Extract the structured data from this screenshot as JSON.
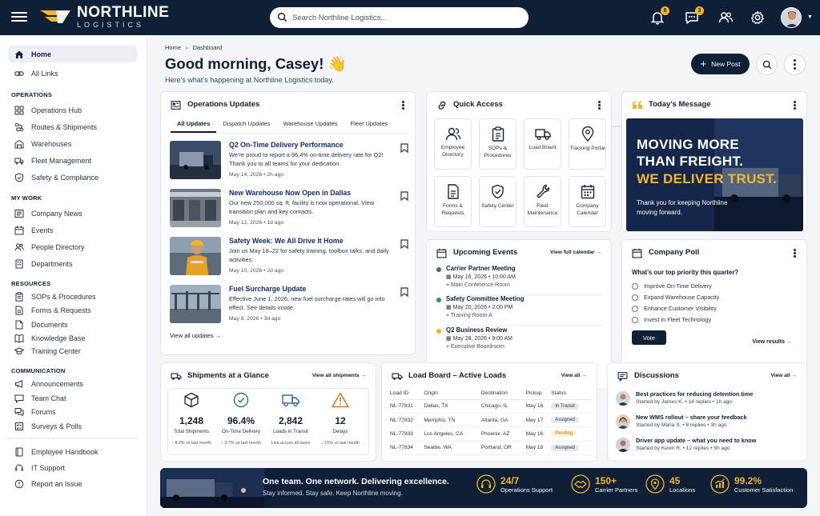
{
  "brand": {
    "name": "NORTHLINE",
    "sub": "LOGISTICS"
  },
  "search": {
    "placeholder": "Search Northline Logistics..."
  },
  "header": {
    "notifications": "8",
    "messages": "3"
  },
  "sidebar": {
    "top": [
      {
        "label": "Home"
      },
      {
        "label": "All Links"
      }
    ],
    "operations_title": "OPERATIONS",
    "operations": [
      {
        "label": "Operations Hub"
      },
      {
        "label": "Routes & Shipments"
      },
      {
        "label": "Warehouses"
      },
      {
        "label": "Fleet Management"
      },
      {
        "label": "Safety & Compliance"
      }
    ],
    "mywork_title": "MY WORK",
    "mywork": [
      {
        "label": "Company News"
      },
      {
        "label": "Events"
      },
      {
        "label": "People Directory"
      },
      {
        "label": "Departments"
      }
    ],
    "resources_title": "RESOURCES",
    "resources": [
      {
        "label": "SOPs & Procedures"
      },
      {
        "label": "Forms & Requests"
      },
      {
        "label": "Documents"
      },
      {
        "label": "Knowledge Base"
      },
      {
        "label": "Training Center"
      }
    ],
    "comm_title": "COMMUNICATION",
    "comm": [
      {
        "label": "Announcements"
      },
      {
        "label": "Team Chat"
      },
      {
        "label": "Forums"
      },
      {
        "label": "Surveys & Polls"
      }
    ],
    "bottom": [
      {
        "label": "Employee Handbook"
      },
      {
        "label": "IT Support"
      },
      {
        "label": "Report an Issue"
      }
    ]
  },
  "page": {
    "breadcrumb": [
      "Home",
      "Dashboard"
    ],
    "greeting": "Good morning, Casey! 👋",
    "subtitle": "Here’s what’s happening at Northline Logistics today.",
    "new_post": "New Post"
  },
  "ops": {
    "title": "Operations Updates",
    "tabs": [
      "All Updates",
      "Dispatch Updates",
      "Warehouse Updates",
      "Fleet Updates"
    ],
    "items": [
      {
        "title": "Q2 On-Time Delivery Performance",
        "desc": "We’re proud to report a 96.4% on-time delivery rate for Q2! Thank you to all teams for your dedication.",
        "date": "May 14, 2026",
        "ago": "2h ago"
      },
      {
        "title": "New Warehouse Now Open in Dallas",
        "desc": "Our new 250,000 sq. ft. facility is now operational. View transition plan and key contacts.",
        "date": "May 12, 2026",
        "ago": "1d ago"
      },
      {
        "title": "Safety Week: We All Drive It Home",
        "desc": "Join us May 18–22 for safety training, toolbox talks, and daily activities.",
        "date": "May 10, 2026",
        "ago": "2d ago"
      },
      {
        "title": "Fuel Surcharge Update",
        "desc": "Effective June 1, 2026, new fuel surcharge rates will go into effect. See details inside.",
        "date": "May 8, 2026",
        "ago": "3d ago"
      }
    ],
    "view_all": "View all updates →"
  },
  "quick": {
    "title": "Quick Access",
    "items": [
      {
        "label": "Employee Directory"
      },
      {
        "label": "SOPs & Procedures"
      },
      {
        "label": "Load Board"
      },
      {
        "label": "Tracking Portal"
      },
      {
        "label": "Forms & Requests"
      },
      {
        "label": "Safety Center"
      },
      {
        "label": "Fleet Maintenance"
      },
      {
        "label": "Company Calendar"
      }
    ]
  },
  "message": {
    "title": "Today’s Message",
    "line1": "MOVING MORE",
    "line2": "THAN FREIGHT.",
    "line3": "WE DELIVER TRUST.",
    "body": "Thank you for keeping Northline moving forward."
  },
  "events": {
    "title": "Upcoming Events",
    "link": "View full calendar →",
    "items": [
      {
        "name": "Carrier Partner Meeting",
        "date": "May 16, 2026  •  10:00 AM",
        "loc": "Main Conference Room",
        "color": "#2e7d4f"
      },
      {
        "name": "Safety Committee Meeting",
        "date": "May 20, 2026  •  2:00 PM",
        "loc": "Training Room A",
        "color": "#2e9a57"
      },
      {
        "name": "Q2 Business Review",
        "date": "May 28, 2026  •  9:00 AM",
        "loc": "Executive Boardroom",
        "color": "#f0b429"
      }
    ]
  },
  "poll": {
    "title": "Company Poll",
    "question": "What’s our top priority this quarter?",
    "options": [
      "Improve On-Time Delivery",
      "Expand Warehouse Capacity",
      "Enhance Customer Visibility",
      "Invest in Fleet Technology"
    ],
    "vote": "Vote",
    "results": "View results →"
  },
  "shipments": {
    "title": "Shipments at a Glance",
    "link": "View all shipments →",
    "stats": [
      {
        "value": "1,248",
        "label": "Total Shipments",
        "sub": "↑ 8.2% vs last month"
      },
      {
        "value": "96.4%",
        "label": "On-Time Delivery",
        "sub": "↑ 3.7% vs last month"
      },
      {
        "value": "2,842",
        "label": "Loads in Transit",
        "sub": "Live across all lanes"
      },
      {
        "value": "12",
        "label": "Delays",
        "sub": "↓ 15% vs last month"
      }
    ]
  },
  "loadboard": {
    "title": "Load Board – Active Loads",
    "link": "View all →",
    "headers": [
      "Load ID",
      "Origin",
      "Destination",
      "Pickup",
      "Status"
    ],
    "rows": [
      {
        "id": "NL-77831",
        "origin": "Dallas, TX",
        "dest": "Chicago, IL",
        "pickup": "May 16",
        "status": "In Transit"
      },
      {
        "id": "NL-77832",
        "origin": "Memphis, TN",
        "dest": "Atlanta, GA",
        "pickup": "May 17",
        "status": "Assigned"
      },
      {
        "id": "NL-77833",
        "origin": "Los Angeles, CA",
        "dest": "Phoenix, AZ",
        "pickup": "May 16",
        "status": "Pending"
      },
      {
        "id": "NL-77834",
        "origin": "Seattle, WA",
        "dest": "Portland, OR",
        "pickup": "May 18",
        "status": "Assigned"
      }
    ]
  },
  "discussions": {
    "title": "Discussions",
    "link": "View all →",
    "items": [
      {
        "title": "Best practices for reducing detention time",
        "meta": "Started by James K.  •  14 replies  •  1h ago"
      },
      {
        "title": "New WMS rollout – share your feedback",
        "meta": "Started by Maria S.  •  8 replies  •  3h ago"
      },
      {
        "title": "Driver app update – what you need to know",
        "meta": "Started by Kevin R.  •  12 replies  •  5h ago"
      }
    ]
  },
  "banner": {
    "title": "One team. One network. Delivering excellence.",
    "sub": "Stay informed. Stay safe. Keep Northline moving.",
    "stats": [
      {
        "value": "24/7",
        "label": "Operations Support"
      },
      {
        "value": "150+",
        "label": "Carrier Partners"
      },
      {
        "value": "45",
        "label": "Locations"
      },
      {
        "value": "99.2%",
        "label": "Customer Satisfaction"
      }
    ]
  }
}
